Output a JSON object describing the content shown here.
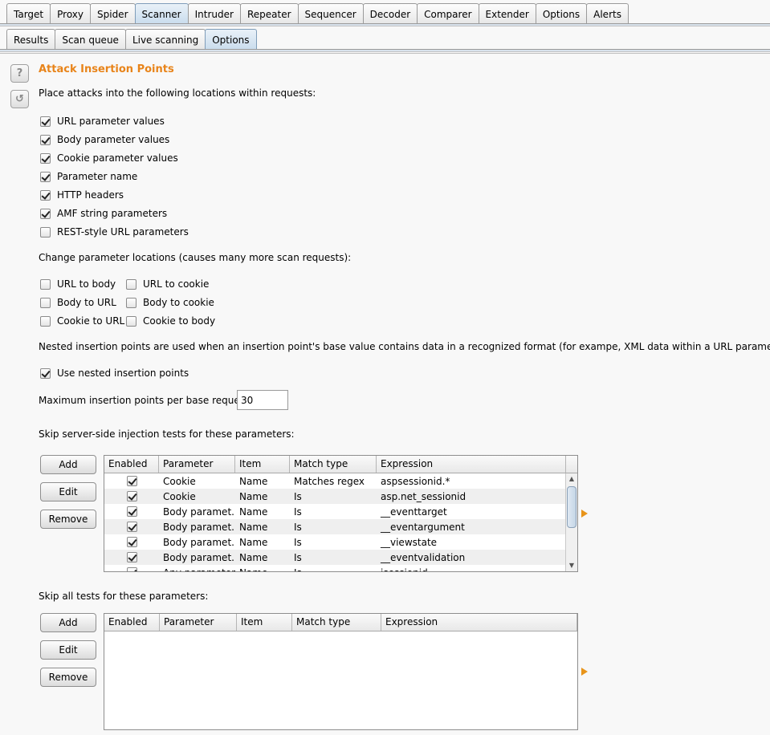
{
  "tabs": [
    "Target",
    "Proxy",
    "Spider",
    "Scanner",
    "Intruder",
    "Repeater",
    "Sequencer",
    "Decoder",
    "Comparer",
    "Extender",
    "Options",
    "Alerts"
  ],
  "active_tab": "Scanner",
  "subtabs": [
    "Results",
    "Scan queue",
    "Live scanning",
    "Options"
  ],
  "active_subtab": "Options",
  "icons": {
    "help": "?",
    "reset": "↺"
  },
  "section": {
    "title": "Attack Insertion Points",
    "intro": "Place attacks into the following locations within requests:",
    "locations": [
      {
        "label": "URL parameter values",
        "checked": true
      },
      {
        "label": "Body parameter values",
        "checked": true
      },
      {
        "label": "Cookie parameter values",
        "checked": true
      },
      {
        "label": "Parameter name",
        "checked": true
      },
      {
        "label": "HTTP headers",
        "checked": true
      },
      {
        "label": "AMF string parameters",
        "checked": true
      },
      {
        "label": "REST-style URL parameters",
        "checked": false
      }
    ],
    "change_intro": "Change parameter locations (causes many more scan requests):",
    "change_left": [
      {
        "label": "URL to body",
        "checked": false
      },
      {
        "label": "Body to URL",
        "checked": false
      },
      {
        "label": "Cookie to URL",
        "checked": false
      }
    ],
    "change_right": [
      {
        "label": "URL to cookie",
        "checked": false
      },
      {
        "label": "Body to cookie",
        "checked": false
      },
      {
        "label": "Cookie to body",
        "checked": false
      }
    ],
    "nested_intro": "Nested insertion points are used when an insertion point's base value contains data in a recognized format (for exampe, XML data within a URL parameter):",
    "nested_label": "Use nested insertion points",
    "nested_checked": true,
    "max_label": "Maximum insertion points per base request:",
    "max_value": "30",
    "skip_server_label": "Skip server-side injection tests for these parameters:",
    "skip_all_label": "Skip all tests for these parameters:"
  },
  "buttons": {
    "add": "Add",
    "edit": "Edit",
    "remove": "Remove"
  },
  "table1": {
    "columns": [
      "Enabled",
      "Parameter",
      "Item",
      "Match type",
      "Expression"
    ],
    "rows": [
      {
        "enabled": true,
        "parameter": "Cookie",
        "item": "Name",
        "match": "Matches regex",
        "expr": "aspsessionid.*"
      },
      {
        "enabled": true,
        "parameter": "Cookie",
        "item": "Name",
        "match": "Is",
        "expr": "asp.net_sessionid"
      },
      {
        "enabled": true,
        "parameter": "Body paramet...",
        "item": "Name",
        "match": "Is",
        "expr": "__eventtarget"
      },
      {
        "enabled": true,
        "parameter": "Body paramet...",
        "item": "Name",
        "match": "Is",
        "expr": "__eventargument"
      },
      {
        "enabled": true,
        "parameter": "Body paramet...",
        "item": "Name",
        "match": "Is",
        "expr": "__viewstate"
      },
      {
        "enabled": true,
        "parameter": "Body paramet...",
        "item": "Name",
        "match": "Is",
        "expr": "__eventvalidation"
      },
      {
        "enabled": true,
        "parameter": "Any parameter",
        "item": "Name",
        "match": "Is",
        "expr": "jsessionid"
      }
    ]
  },
  "table2": {
    "columns": [
      "Enabled",
      "Parameter",
      "Item",
      "Match type",
      "Expression"
    ],
    "rows": []
  }
}
